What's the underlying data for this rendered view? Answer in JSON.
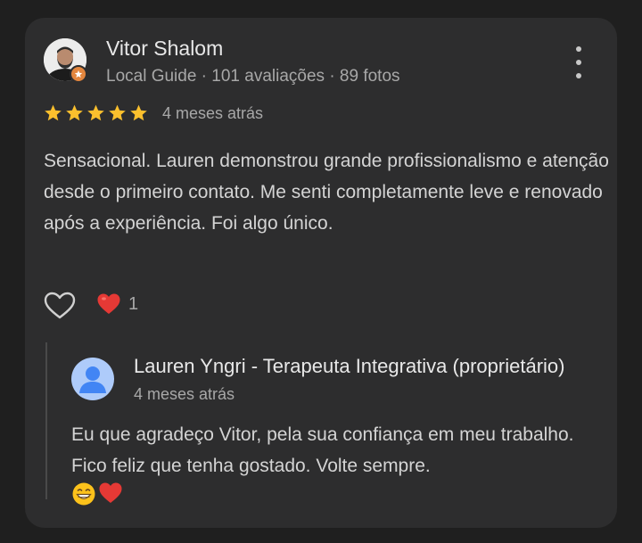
{
  "review": {
    "reviewer_name": "Vitor Shalom",
    "reviewer_meta": "Local Guide · 101 avaliações · 89 fotos",
    "rating": 5,
    "time": "4 meses atrás",
    "text": "Sensacional. Lauren demonstrou grande profissionalismo e atenção desde o primeiro contato. Me senti completamente leve e renovado após a experiência. Foi algo único.",
    "reaction_count": "1"
  },
  "reply": {
    "owner_name": "Lauren Yngri - Terapeuta Integrativa (proprietário)",
    "time": "4 meses atrás",
    "text": "Eu que agradeço Vitor, pela sua confiança em meu trabalho. Fico feliz que tenha gostado. Volte sempre."
  },
  "colors": {
    "background": "#1f1f1f",
    "card": "#2d2d2e",
    "star": "#fbc02d",
    "badge": "#e3863e",
    "heart_reaction": "#e53935",
    "owner_avatar": "#aecbfa",
    "owner_avatar_figure": "#4285f4"
  },
  "icons": {
    "more": "more-vert-icon",
    "like": "heart-outline-icon",
    "reaction": "red-heart-icon",
    "guide_badge": "local-guide-star-icon"
  }
}
